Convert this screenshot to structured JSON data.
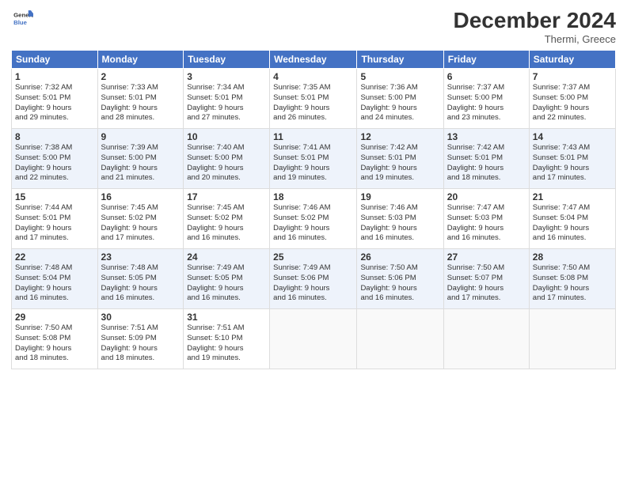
{
  "header": {
    "logo_line1": "General",
    "logo_line2": "Blue",
    "month": "December 2024",
    "location": "Thermi, Greece"
  },
  "days_of_week": [
    "Sunday",
    "Monday",
    "Tuesday",
    "Wednesday",
    "Thursday",
    "Friday",
    "Saturday"
  ],
  "weeks": [
    [
      {
        "day": "1",
        "info": "Sunrise: 7:32 AM\nSunset: 5:01 PM\nDaylight: 9 hours\nand 29 minutes."
      },
      {
        "day": "2",
        "info": "Sunrise: 7:33 AM\nSunset: 5:01 PM\nDaylight: 9 hours\nand 28 minutes."
      },
      {
        "day": "3",
        "info": "Sunrise: 7:34 AM\nSunset: 5:01 PM\nDaylight: 9 hours\nand 27 minutes."
      },
      {
        "day": "4",
        "info": "Sunrise: 7:35 AM\nSunset: 5:01 PM\nDaylight: 9 hours\nand 26 minutes."
      },
      {
        "day": "5",
        "info": "Sunrise: 7:36 AM\nSunset: 5:00 PM\nDaylight: 9 hours\nand 24 minutes."
      },
      {
        "day": "6",
        "info": "Sunrise: 7:37 AM\nSunset: 5:00 PM\nDaylight: 9 hours\nand 23 minutes."
      },
      {
        "day": "7",
        "info": "Sunrise: 7:37 AM\nSunset: 5:00 PM\nDaylight: 9 hours\nand 22 minutes."
      }
    ],
    [
      {
        "day": "8",
        "info": "Sunrise: 7:38 AM\nSunset: 5:00 PM\nDaylight: 9 hours\nand 22 minutes."
      },
      {
        "day": "9",
        "info": "Sunrise: 7:39 AM\nSunset: 5:00 PM\nDaylight: 9 hours\nand 21 minutes."
      },
      {
        "day": "10",
        "info": "Sunrise: 7:40 AM\nSunset: 5:00 PM\nDaylight: 9 hours\nand 20 minutes."
      },
      {
        "day": "11",
        "info": "Sunrise: 7:41 AM\nSunset: 5:01 PM\nDaylight: 9 hours\nand 19 minutes."
      },
      {
        "day": "12",
        "info": "Sunrise: 7:42 AM\nSunset: 5:01 PM\nDaylight: 9 hours\nand 19 minutes."
      },
      {
        "day": "13",
        "info": "Sunrise: 7:42 AM\nSunset: 5:01 PM\nDaylight: 9 hours\nand 18 minutes."
      },
      {
        "day": "14",
        "info": "Sunrise: 7:43 AM\nSunset: 5:01 PM\nDaylight: 9 hours\nand 17 minutes."
      }
    ],
    [
      {
        "day": "15",
        "info": "Sunrise: 7:44 AM\nSunset: 5:01 PM\nDaylight: 9 hours\nand 17 minutes."
      },
      {
        "day": "16",
        "info": "Sunrise: 7:45 AM\nSunset: 5:02 PM\nDaylight: 9 hours\nand 17 minutes."
      },
      {
        "day": "17",
        "info": "Sunrise: 7:45 AM\nSunset: 5:02 PM\nDaylight: 9 hours\nand 16 minutes."
      },
      {
        "day": "18",
        "info": "Sunrise: 7:46 AM\nSunset: 5:02 PM\nDaylight: 9 hours\nand 16 minutes."
      },
      {
        "day": "19",
        "info": "Sunrise: 7:46 AM\nSunset: 5:03 PM\nDaylight: 9 hours\nand 16 minutes."
      },
      {
        "day": "20",
        "info": "Sunrise: 7:47 AM\nSunset: 5:03 PM\nDaylight: 9 hours\nand 16 minutes."
      },
      {
        "day": "21",
        "info": "Sunrise: 7:47 AM\nSunset: 5:04 PM\nDaylight: 9 hours\nand 16 minutes."
      }
    ],
    [
      {
        "day": "22",
        "info": "Sunrise: 7:48 AM\nSunset: 5:04 PM\nDaylight: 9 hours\nand 16 minutes."
      },
      {
        "day": "23",
        "info": "Sunrise: 7:48 AM\nSunset: 5:05 PM\nDaylight: 9 hours\nand 16 minutes."
      },
      {
        "day": "24",
        "info": "Sunrise: 7:49 AM\nSunset: 5:05 PM\nDaylight: 9 hours\nand 16 minutes."
      },
      {
        "day": "25",
        "info": "Sunrise: 7:49 AM\nSunset: 5:06 PM\nDaylight: 9 hours\nand 16 minutes."
      },
      {
        "day": "26",
        "info": "Sunrise: 7:50 AM\nSunset: 5:06 PM\nDaylight: 9 hours\nand 16 minutes."
      },
      {
        "day": "27",
        "info": "Sunrise: 7:50 AM\nSunset: 5:07 PM\nDaylight: 9 hours\nand 17 minutes."
      },
      {
        "day": "28",
        "info": "Sunrise: 7:50 AM\nSunset: 5:08 PM\nDaylight: 9 hours\nand 17 minutes."
      }
    ],
    [
      {
        "day": "29",
        "info": "Sunrise: 7:50 AM\nSunset: 5:08 PM\nDaylight: 9 hours\nand 18 minutes."
      },
      {
        "day": "30",
        "info": "Sunrise: 7:51 AM\nSunset: 5:09 PM\nDaylight: 9 hours\nand 18 minutes."
      },
      {
        "day": "31",
        "info": "Sunrise: 7:51 AM\nSunset: 5:10 PM\nDaylight: 9 hours\nand 19 minutes."
      },
      {
        "day": "",
        "info": ""
      },
      {
        "day": "",
        "info": ""
      },
      {
        "day": "",
        "info": ""
      },
      {
        "day": "",
        "info": ""
      }
    ]
  ]
}
